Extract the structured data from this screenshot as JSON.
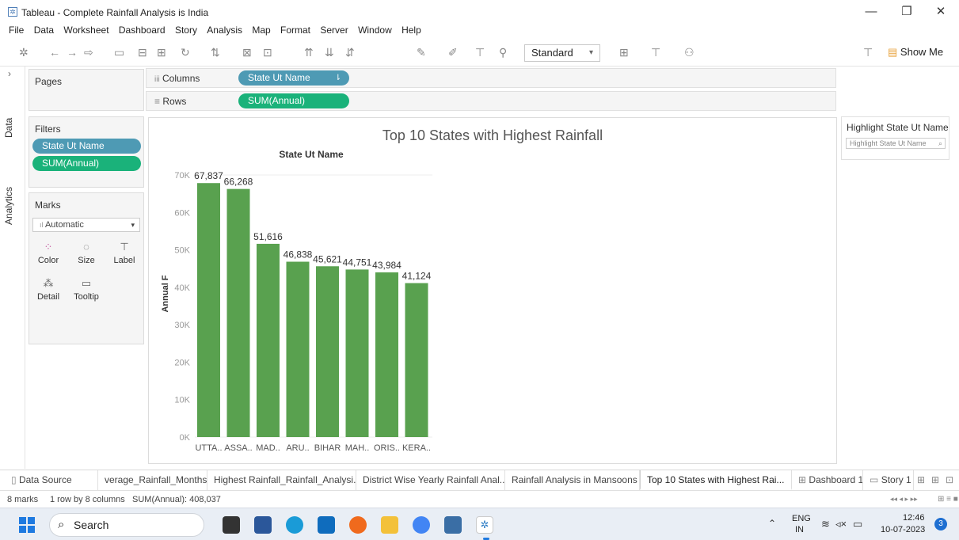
{
  "window": {
    "title": "Tableau - Complete Rainfall Analysis is India",
    "app_icon": "tableau-icon",
    "controls": [
      "minimize",
      "restore",
      "close"
    ]
  },
  "menu": [
    "File",
    "Data",
    "Worksheet",
    "Dashboard",
    "Story",
    "Analysis",
    "Map",
    "Format",
    "Server",
    "Window",
    "Help"
  ],
  "toolbar": {
    "fit_dropdown": "Standard",
    "show_me": "Show Me"
  },
  "side_tabs": {
    "data": "Data",
    "analytics": "Analytics"
  },
  "pages": {
    "title": "Pages"
  },
  "filters": {
    "title": "Filters",
    "pills": [
      "State Ut Name",
      "SUM(Annual)"
    ]
  },
  "marks": {
    "title": "Marks",
    "type": "Automatic",
    "buttons": [
      "Color",
      "Size",
      "Label",
      "Detail",
      "Tooltip"
    ]
  },
  "shelves": {
    "columns_label": "Columns",
    "columns_pill": "State Ut Name",
    "rows_label": "Rows",
    "rows_pill": "SUM(Annual)"
  },
  "highlight": {
    "title": "Highlight State Ut Name",
    "placeholder": "Highlight State Ut Name"
  },
  "chart_data": {
    "type": "bar",
    "title": "Top 10 States with Highest Rainfall",
    "header": "State Ut Name",
    "ylabel": "Annual F",
    "categories": [
      "UTTA..",
      "ASSA..",
      "MAD..",
      "ARU..",
      "BIHAR",
      "MAH..",
      "ORIS..",
      "KERA.."
    ],
    "values": [
      67837,
      66268,
      51616,
      46838,
      45621,
      44751,
      43984,
      41124
    ],
    "data_labels": [
      "67,837",
      "66,268",
      "51,616",
      "46,838",
      "45,621",
      "44,751",
      "43,984",
      "41,124"
    ],
    "yticks": [
      0,
      10000,
      20000,
      30000,
      40000,
      50000,
      60000,
      70000
    ],
    "ytick_labels": [
      "0K",
      "10K",
      "20K",
      "30K",
      "40K",
      "50K",
      "60K",
      "70K"
    ],
    "ylim": [
      0,
      70000
    ],
    "bar_color": "#59a14f",
    "grid": false
  },
  "sheet_tabs": {
    "data_source": "Data Source",
    "tabs": [
      "verage_Rainfall_Months",
      "Highest Rainfall_Rainfall_Analysi...",
      "District Wise Yearly Rainfall Anal...",
      "Rainfall Analysis in Mansoons",
      "Top 10 States with Highest Rai...",
      "Dashboard 1",
      "Story 1"
    ],
    "active_index": 4
  },
  "status": {
    "marks": "8 marks",
    "shape": "1 row by 8 columns",
    "sum": "SUM(Annual): 408,037"
  },
  "taskbar": {
    "search": "Search",
    "lang_top": "ENG",
    "lang_bottom": "IN",
    "time": "12:46",
    "date": "10-07-2023",
    "notifications": "3"
  }
}
